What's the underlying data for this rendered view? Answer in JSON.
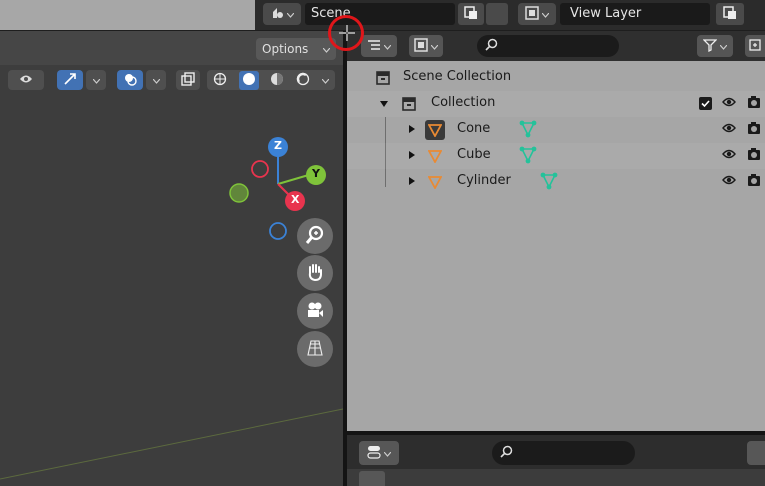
{
  "topbar": {
    "scene_label": "Scene",
    "view_layer_label": "View Layer"
  },
  "viewport": {
    "options_label": "Options",
    "gizmo": {
      "z": "Z",
      "y": "Y",
      "x": "X"
    }
  },
  "outliner": {
    "search_placeholder": "",
    "tree": [
      {
        "label": "Scene Collection",
        "type": "scene-collection"
      },
      {
        "label": "Collection",
        "type": "collection",
        "expanded": true
      },
      {
        "label": "Cone",
        "type": "object"
      },
      {
        "label": "Cube",
        "type": "object"
      },
      {
        "label": "Cylinder",
        "type": "object"
      }
    ]
  },
  "properties": {
    "search_placeholder": ""
  },
  "colors": {
    "axis_x": "#e8344e",
    "axis_y": "#7fc33a",
    "axis_z": "#3b82d6",
    "object_orange": "#e98a33",
    "mesh_green": "#24c29a",
    "accent_blue": "#4272b4",
    "cursor_ring": "#e0161a"
  }
}
